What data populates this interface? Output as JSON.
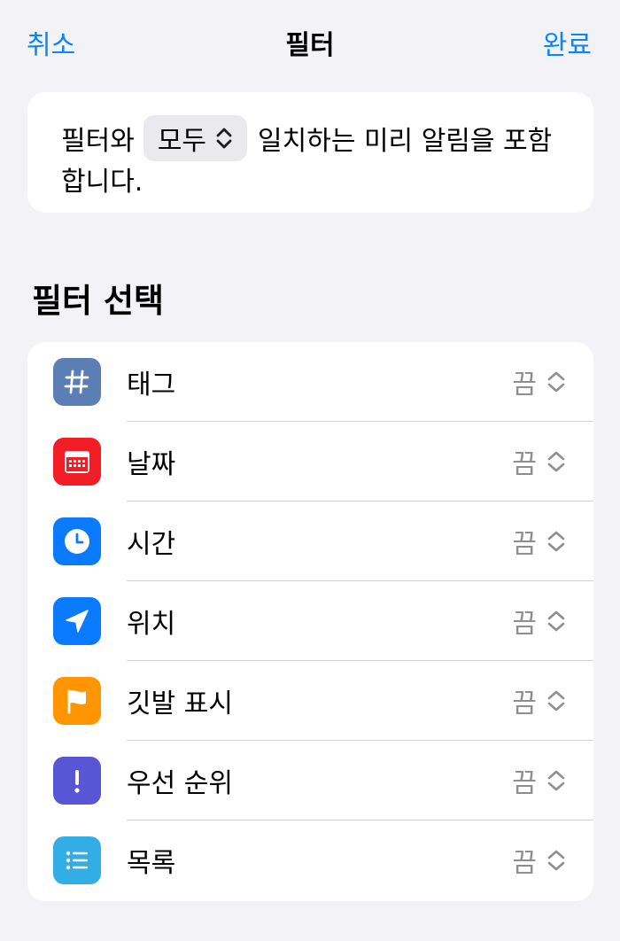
{
  "nav": {
    "cancel": "취소",
    "title": "필터",
    "done": "완료"
  },
  "match": {
    "prefix": "필터와",
    "mode": "모두",
    "suffix": "일치하는 미리 알림을 포함",
    "line2": "합니다."
  },
  "section": {
    "title": "필터 선택"
  },
  "filters": [
    {
      "label": "태그",
      "value": "끔",
      "icon": "hashtag-icon",
      "color": "#5b7fb5"
    },
    {
      "label": "날짜",
      "value": "끔",
      "icon": "calendar-icon",
      "color": "#f21d25"
    },
    {
      "label": "시간",
      "value": "끔",
      "icon": "clock-icon",
      "color": "#0a7aff"
    },
    {
      "label": "위치",
      "value": "끔",
      "icon": "location-arrow-icon",
      "color": "#0a7aff"
    },
    {
      "label": "깃발 표시",
      "value": "끔",
      "icon": "flag-icon",
      "color": "#ff9500"
    },
    {
      "label": "우선 순위",
      "value": "끔",
      "icon": "exclamation-icon",
      "color": "#5856d6"
    },
    {
      "label": "목록",
      "value": "끔",
      "icon": "list-icon",
      "color": "#32ade6"
    }
  ]
}
